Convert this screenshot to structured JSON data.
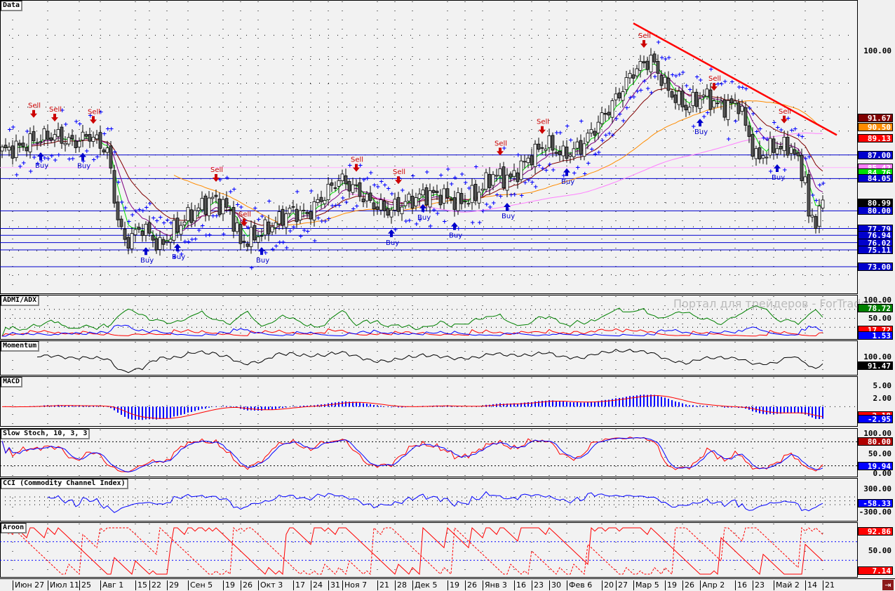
{
  "panels": {
    "main": "Data",
    "adx": "ADMI/ADX",
    "momentum": "Momentum",
    "macd": "MACD",
    "stoch": "Slow Stoch, 10, 3, 3",
    "cci": "CCI (Commodity Channel Index)",
    "aroon": "Aroon"
  },
  "watermark": "Портал для трейдеров - ForTrader.ru",
  "signal_labels": {
    "buy": "Buy",
    "sell": "Sell"
  },
  "axis_tags": {
    "main": [
      {
        "text": "100.00",
        "color": "",
        "value": 100
      },
      {
        "text": "91.67",
        "color": "#800000",
        "value": 91.67
      },
      {
        "text": "90.50",
        "color": "#ff8c00",
        "value": 90.5
      },
      {
        "text": "89.13",
        "color": "#ff0000",
        "value": 89.13
      },
      {
        "text": "87.00",
        "color": "#0000cc",
        "value": 87.0
      },
      {
        "text": "85.42",
        "color": "#ff80ff",
        "value": 85.42
      },
      {
        "text": "84.76",
        "color": "#00e000",
        "value": 84.76
      },
      {
        "text": "84.05",
        "color": "#0000cc",
        "value": 84.05
      },
      {
        "text": "80.99",
        "color": "#000000",
        "value": 80.99
      },
      {
        "text": "80.00",
        "color": "#0000cc",
        "value": 80.0
      },
      {
        "text": "77.79",
        "color": "#0000cc",
        "value": 77.79
      },
      {
        "text": "76.94",
        "color": "#0000cc",
        "value": 76.94
      },
      {
        "text": "76.02",
        "color": "#0000cc",
        "value": 76.02
      },
      {
        "text": "75.11",
        "color": "#0000cc",
        "value": 75.11
      },
      {
        "text": "73.00",
        "color": "#0000cc",
        "value": 73.0
      }
    ],
    "adx": [
      {
        "text": "100.00",
        "color": "",
        "value": 100
      },
      {
        "text": "78.72",
        "color": "#008000",
        "value": 78.72
      },
      {
        "text": "50.00",
        "color": "",
        "value": 50
      },
      {
        "text": "17.72",
        "color": "#ff0000",
        "value": 17.72
      },
      {
        "text": "1.53",
        "color": "#0000ff",
        "value": 1.53
      }
    ],
    "momentum": [
      {
        "text": "100.00",
        "color": "",
        "value": 100
      },
      {
        "text": "91.47",
        "color": "#000000",
        "value": 91.47
      }
    ],
    "macd": [
      {
        "text": "5.00",
        "color": "",
        "value": 5
      },
      {
        "text": "2.00",
        "color": "",
        "value": 2
      },
      {
        "text": "-2.18",
        "color": "#ff0000",
        "value": -2.18
      },
      {
        "text": "-2.95",
        "color": "#0000ff",
        "value": -2.95
      }
    ],
    "stoch": [
      {
        "text": "100.00",
        "color": "",
        "value": 100
      },
      {
        "text": "80.00",
        "color": "#b00000",
        "value": 80
      },
      {
        "text": "50.00",
        "color": "",
        "value": 50
      },
      {
        "text": "19.94",
        "color": "#0000ff",
        "value": 19.94
      },
      {
        "text": "0.00",
        "color": "",
        "value": 0
      }
    ],
    "cci": [
      {
        "text": "300.00",
        "color": "",
        "value": 300
      },
      {
        "text": "-58.33",
        "color": "#0000ff",
        "value": -58.33
      },
      {
        "text": "-300.00",
        "color": "",
        "value": -300
      }
    ],
    "aroon": [
      {
        "text": "92.86",
        "color": "#ff0000",
        "value": 92.86
      },
      {
        "text": "50.00",
        "color": "",
        "value": 50
      },
      {
        "text": "7.14",
        "color": "#ff0000",
        "value": 7.14
      }
    ]
  },
  "dates": [
    "Июн 27",
    "Июл 11",
    "25",
    "Авг 1",
    "15",
    "22",
    "29",
    "Сен 5",
    "19",
    "26",
    "Окт 3",
    "17",
    "24",
    "31",
    "Ноя 7",
    "21",
    "28",
    "Дек 5",
    "19",
    "26",
    "Янв 3",
    "16",
    "23",
    "30",
    "Фев 6",
    "20",
    "27",
    "Мар 5",
    "19",
    "26",
    "Апр 2",
    "16",
    "23",
    "Май 2",
    "14",
    "21"
  ],
  "date_days": [
    3,
    13,
    22,
    28,
    38,
    42,
    47,
    53,
    63,
    68,
    73,
    83,
    88,
    93,
    97,
    107,
    112,
    117,
    127,
    132,
    137,
    146,
    151,
    156,
    161,
    171,
    175,
    180,
    189,
    194,
    199,
    209,
    214,
    220,
    229,
    234
  ],
  "chart_data": {
    "type": "candlestick",
    "title": "Data",
    "x_unit": "trading day index",
    "close_keypoints": [
      [
        0,
        87.5
      ],
      [
        5,
        88
      ],
      [
        10,
        89
      ],
      [
        15,
        89.5
      ],
      [
        20,
        88.5
      ],
      [
        25,
        89.5
      ],
      [
        30,
        87.5
      ],
      [
        33,
        79
      ],
      [
        35,
        76
      ],
      [
        40,
        78
      ],
      [
        45,
        75.5
      ],
      [
        50,
        78
      ],
      [
        55,
        80
      ],
      [
        60,
        81.5
      ],
      [
        65,
        80
      ],
      [
        68,
        76
      ],
      [
        73,
        77
      ],
      [
        78,
        78.5
      ],
      [
        82,
        80
      ],
      [
        87,
        79.5
      ],
      [
        92,
        82
      ],
      [
        96,
        84
      ],
      [
        100,
        83
      ],
      [
        105,
        81
      ],
      [
        110,
        80
      ],
      [
        115,
        81
      ],
      [
        120,
        82
      ],
      [
        125,
        82
      ],
      [
        130,
        81
      ],
      [
        135,
        82
      ],
      [
        140,
        84.5
      ],
      [
        145,
        84
      ],
      [
        150,
        86.5
      ],
      [
        155,
        88.5
      ],
      [
        160,
        87
      ],
      [
        165,
        88
      ],
      [
        170,
        91
      ],
      [
        175,
        94
      ],
      [
        180,
        97.5
      ],
      [
        185,
        99
      ],
      [
        190,
        95
      ],
      [
        195,
        93
      ],
      [
        200,
        94.5
      ],
      [
        205,
        93
      ],
      [
        210,
        93.5
      ],
      [
        215,
        86.5
      ],
      [
        220,
        88
      ],
      [
        225,
        88
      ],
      [
        229,
        84
      ],
      [
        230,
        79
      ],
      [
        232,
        79
      ],
      [
        234,
        81
      ]
    ],
    "ylim": [
      70,
      103
    ],
    "horizontal_levels": [
      87.0,
      84.05,
      80.0,
      77.79,
      76.94,
      76.02,
      75.11,
      73.0
    ],
    "pink_level": 85.42,
    "trendline": [
      [
        180,
        103.5
      ],
      [
        238,
        89.5
      ]
    ],
    "signals": [
      {
        "type": "sell",
        "day": 9
      },
      {
        "type": "sell",
        "day": 15
      },
      {
        "type": "sell",
        "day": 26
      },
      {
        "type": "sell",
        "day": 61
      },
      {
        "type": "sell",
        "day": 69
      },
      {
        "type": "sell",
        "day": 101
      },
      {
        "type": "sell",
        "day": 113
      },
      {
        "type": "sell",
        "day": 142
      },
      {
        "type": "sell",
        "day": 154
      },
      {
        "type": "sell",
        "day": 183
      },
      {
        "type": "sell",
        "day": 203
      },
      {
        "type": "sell",
        "day": 223
      },
      {
        "type": "buy",
        "day": 11
      },
      {
        "type": "buy",
        "day": 23
      },
      {
        "type": "buy",
        "day": 41
      },
      {
        "type": "buy",
        "day": 50
      },
      {
        "type": "buy",
        "day": 74
      },
      {
        "type": "buy",
        "day": 111
      },
      {
        "type": "buy",
        "day": 120
      },
      {
        "type": "buy",
        "day": 129
      },
      {
        "type": "buy",
        "day": 144
      },
      {
        "type": "buy",
        "day": 161
      },
      {
        "type": "buy",
        "day": 199
      },
      {
        "type": "buy",
        "day": 221
      }
    ],
    "indicators": [
      "EMA 5 (green)",
      "EMA 10 (purple)",
      "EMA 21 (dark red)",
      "SMA 50 (orange)",
      "SMA 100 (pink)",
      "Parabolic SAR (blue)"
    ]
  }
}
